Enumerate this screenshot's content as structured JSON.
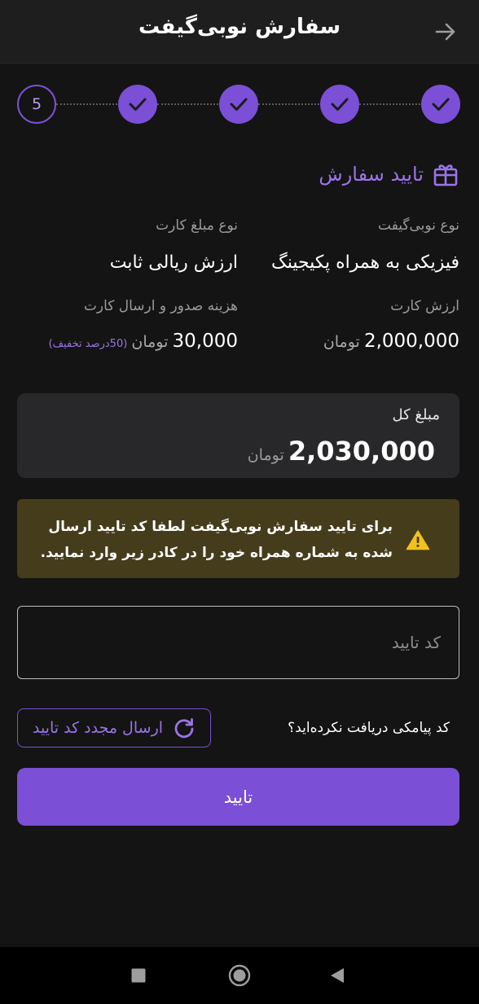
{
  "header": {
    "title": "سفارش نوبی‌گیفت",
    "back_icon": "arrow-right-icon"
  },
  "stepper": {
    "steps": [
      {
        "state": "done"
      },
      {
        "state": "done"
      },
      {
        "state": "done"
      },
      {
        "state": "done"
      },
      {
        "state": "current",
        "number": "5"
      }
    ]
  },
  "section": {
    "title": "تایید سفارش",
    "icon": "gift-icon"
  },
  "info": {
    "gift_type_label": "نوع نوبی‌گیفت",
    "gift_type_value": "فیزیکی به همراه پکیجینگ",
    "card_amount_type_label": "نوع مبلغ کارت",
    "card_amount_type_value": "ارزش ریالی ثابت",
    "card_value_label": "ارزش کارت",
    "card_value_amount": "2,000,000",
    "card_value_currency": "تومان",
    "fee_label": "هزینه صدور و ارسال کارت",
    "fee_amount": "30,000",
    "fee_currency": "تومان",
    "fee_discount": "(50درصد تخفیف)"
  },
  "total": {
    "label": "مبلغ کل",
    "amount": "2,030,000",
    "currency": "تومان"
  },
  "warning": {
    "text": "برای تایید سفارش نوبی‌گیفت لطفا کد تایید ارسال شده به شماره همراه خود را در کادر زیر وارد نمایید.",
    "icon": "warning-icon"
  },
  "code_input": {
    "placeholder": "کد تایید",
    "value": ""
  },
  "resend": {
    "question": "کد پیامکی دریافت نکرده‌اید؟",
    "button_label": "ارسال مجدد کد تایید"
  },
  "confirm": {
    "label": "تایید"
  },
  "colors": {
    "accent": "#7b4fd6",
    "background": "#141414",
    "warning_bg": "#453c1b",
    "warning_icon": "#f2c21b"
  }
}
